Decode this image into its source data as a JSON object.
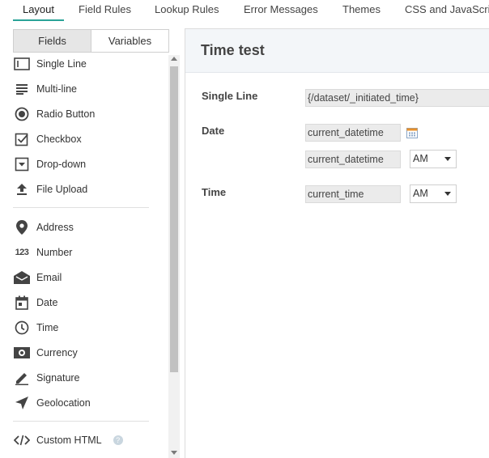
{
  "tabs": [
    {
      "label": "Layout",
      "active": true
    },
    {
      "label": "Field Rules"
    },
    {
      "label": "Lookup Rules"
    },
    {
      "label": "Error Messages"
    },
    {
      "label": "Themes"
    },
    {
      "label": "CSS and JavaScript"
    }
  ],
  "segmented": {
    "fields_label": "Fields",
    "variables_label": "Variables",
    "active": "Fields"
  },
  "fields": [
    {
      "label": "Single Line",
      "icon": "single-line-icon"
    },
    {
      "label": "Multi-line",
      "icon": "multi-line-icon"
    },
    {
      "label": "Radio Button",
      "icon": "radio-button-icon"
    },
    {
      "label": "Checkbox",
      "icon": "checkbox-icon"
    },
    {
      "label": "Drop-down",
      "icon": "dropdown-icon"
    },
    {
      "label": "File Upload",
      "icon": "upload-icon"
    },
    {
      "label": "Address",
      "icon": "map-pin-icon"
    },
    {
      "label": "Number",
      "icon": "number-icon"
    },
    {
      "label": "Email",
      "icon": "email-icon"
    },
    {
      "label": "Date",
      "icon": "calendar-icon"
    },
    {
      "label": "Time",
      "icon": "clock-icon"
    },
    {
      "label": "Currency",
      "icon": "currency-icon"
    },
    {
      "label": "Signature",
      "icon": "pen-icon"
    },
    {
      "label": "Geolocation",
      "icon": "location-arrow-icon"
    },
    {
      "label": "Custom HTML",
      "icon": "code-icon"
    }
  ],
  "number_icon_text": "123",
  "help_icon_text": "?",
  "form": {
    "title": "Time test",
    "single_line_label": "Single Line",
    "single_line_value": "{/dataset/_initiated_time}",
    "date_label": "Date",
    "date_value": "current_datetime",
    "datetime_value": "current_datetime",
    "datetime_ampm": "AM",
    "time_label": "Time",
    "time_value": "current_time",
    "time_ampm": "AM"
  },
  "colors": {
    "accent": "#2aa397",
    "header_bg": "#f3f6f9",
    "input_bg": "#ebebeb"
  }
}
